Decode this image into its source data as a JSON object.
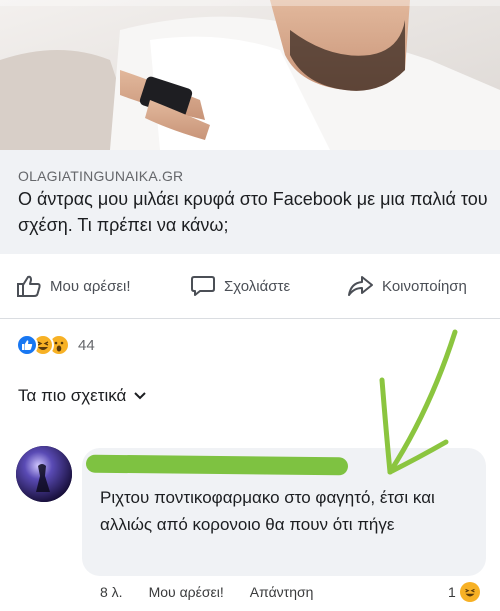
{
  "post": {
    "domain": "OLAGIATINGUNAIKA.GR",
    "headline": "Ο άντρας μου μιλάει κρυφά στο Facebook με μια παλιά του σχέση. Τι πρέπει να κάνω;"
  },
  "actions": {
    "like": "Μου αρέσει!",
    "comment": "Σχολιάστε",
    "share": "Κοινοποίηση"
  },
  "reactions": {
    "count": "44",
    "icons": [
      "like-icon",
      "haha-icon",
      "wow-icon"
    ]
  },
  "comments_filter": {
    "label": "Τα πιο σχετικά"
  },
  "comment": {
    "text": "Ριχτου ποντικοφαρμακο στο φαγητό, έτσι και αλλιώς από κορονοιο θα πουν ότι πήγε",
    "time": "8 λ.",
    "like_label": "Μου αρέσει!",
    "reply_label": "Απάντηση",
    "reaction_count": "1"
  },
  "colors": {
    "accent": "#1877f2",
    "bubble": "#f0f2f5",
    "annotation": "#8bc53f"
  }
}
